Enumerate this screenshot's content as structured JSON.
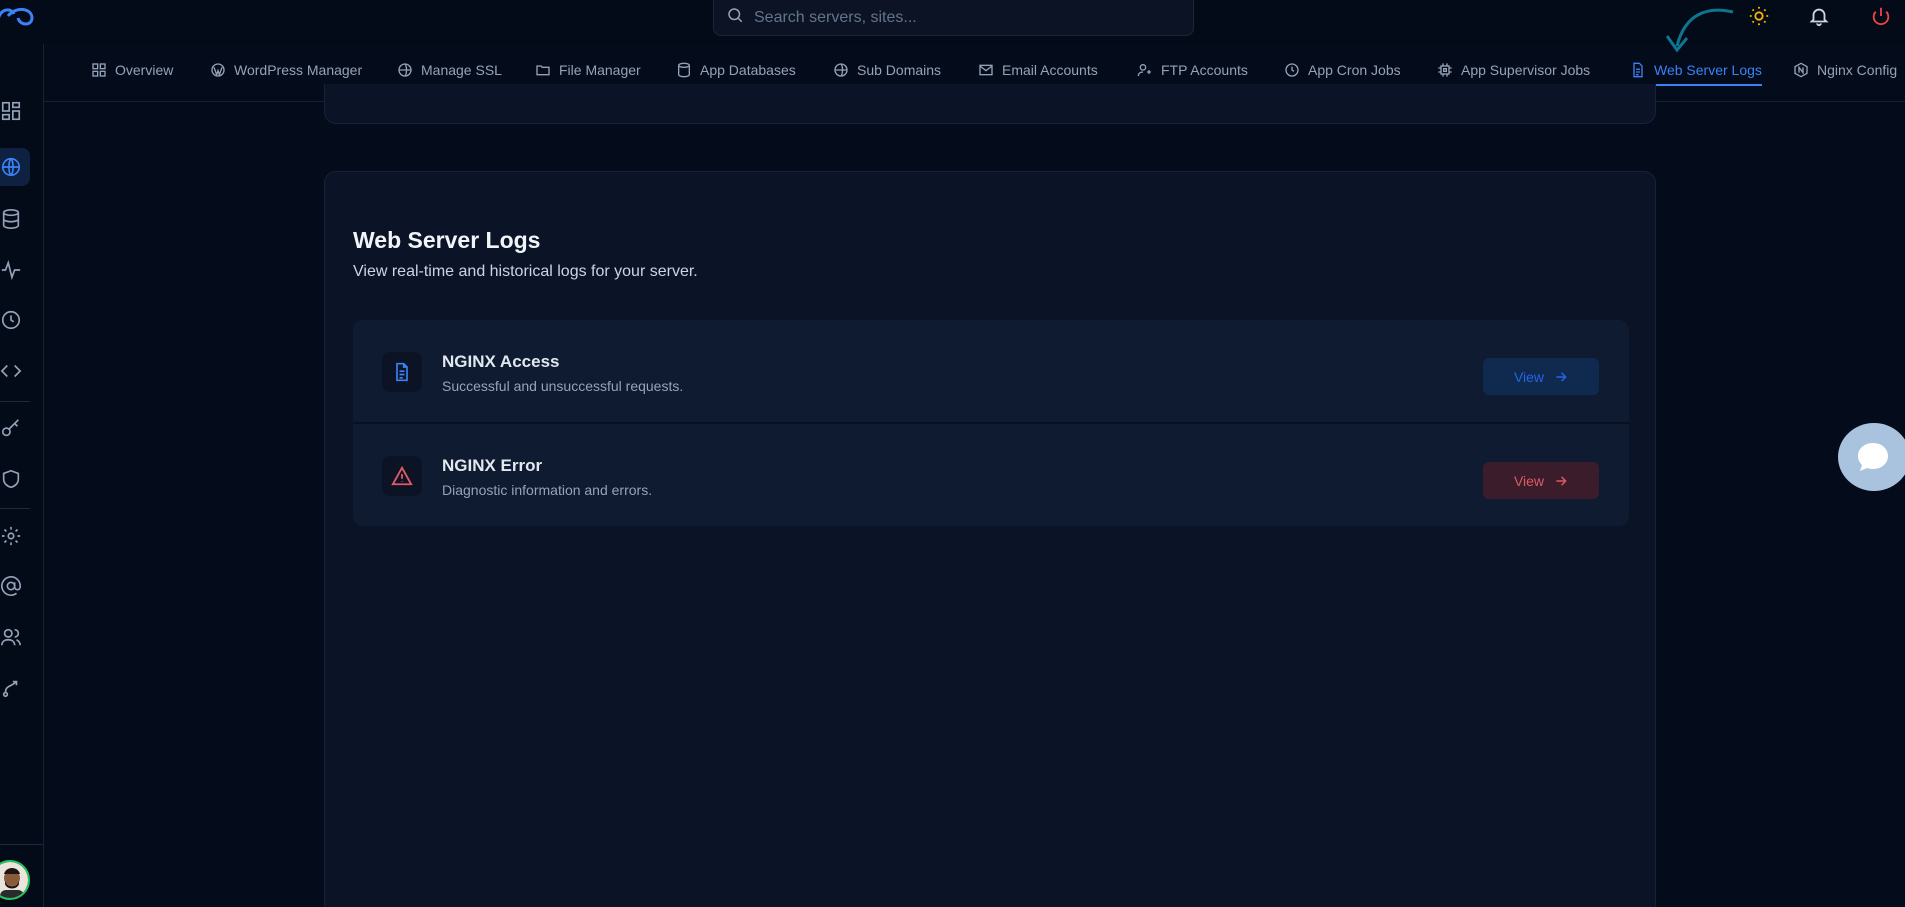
{
  "search": {
    "placeholder": "Search servers, sites..."
  },
  "topbar_icons": [
    "logo-icon",
    "search-icon",
    "sun-icon",
    "bell-icon",
    "power-icon"
  ],
  "rail": {
    "items": [
      "dashboard-icon",
      "globe-icon",
      "database-icon",
      "activity-icon",
      "clock-icon",
      "code-icon",
      "key-icon",
      "shield-icon",
      "settings-icon",
      "at-icon",
      "users-icon",
      "route-icon"
    ],
    "active": "globe-icon"
  },
  "tabs": [
    {
      "label": "Overview",
      "icon": "grid-icon"
    },
    {
      "label": "WordPress Manager",
      "icon": "wordpress-icon"
    },
    {
      "label": "Manage SSL",
      "icon": "globe-icon"
    },
    {
      "label": "File Manager",
      "icon": "folder-icon"
    },
    {
      "label": "App Databases",
      "icon": "database-icon"
    },
    {
      "label": "Sub Domains",
      "icon": "globe-icon"
    },
    {
      "label": "Email Accounts",
      "icon": "mail-icon"
    },
    {
      "label": "FTP Accounts",
      "icon": "user-plus-icon"
    },
    {
      "label": "App Cron Jobs",
      "icon": "clock-globe-icon"
    },
    {
      "label": "App Supervisor Jobs",
      "icon": "cpu-icon"
    },
    {
      "label": "Web Server Logs",
      "icon": "file-text-icon",
      "active": true
    },
    {
      "label": "Nginx Config",
      "icon": "hexagon-icon"
    }
  ],
  "main": {
    "title": "Web Server Logs",
    "subtitle": "View real-time and historical logs for your server.",
    "logs": [
      {
        "name": "NGINX Access",
        "description": "Successful and unsuccessful requests.",
        "button": "View",
        "icon": "file-text-icon",
        "accent": "#2563eb"
      },
      {
        "name": "NGINX Error",
        "description": "Diagnostic information and errors.",
        "button": "View",
        "icon": "warning-icon",
        "accent": "#e05a64"
      }
    ]
  },
  "colors": {
    "background": "#040b1a",
    "card": "#0b1426",
    "active_tab": "#3b82f6",
    "annotation_arrow": "#0e7490"
  }
}
